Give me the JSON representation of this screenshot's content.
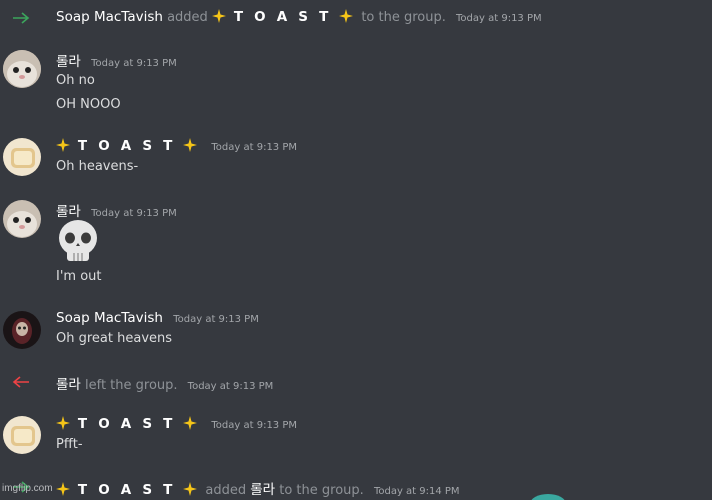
{
  "messages": {
    "join1": {
      "actor": "Soap MacTavish",
      "verb": "added",
      "target": "T O A S T",
      "suffix": "to the group.",
      "time": "Today at 9:13 PM"
    },
    "m1": {
      "author": "롤라",
      "time": "Today at 9:13 PM",
      "lines": [
        "Oh no",
        "OH NOOO"
      ]
    },
    "m2": {
      "author": "T O A S T",
      "time": "Today at 9:13 PM",
      "line": "Oh heavens-"
    },
    "m3": {
      "author": "롤라",
      "time": "Today at 9:13 PM",
      "emoji": "skull-emoji",
      "line": "I'm out"
    },
    "m4": {
      "author": "Soap MacTavish",
      "time": "Today at 9:13 PM",
      "line": "Oh great heavens"
    },
    "leave1": {
      "actor": "롤라",
      "suffix": "left the group.",
      "time": "Today at 9:13 PM"
    },
    "m5": {
      "author": "T O A S T",
      "time": "Today at 9:13 PM",
      "line": "Pfft-"
    },
    "join2": {
      "actor": "T O A S T",
      "verb": "added",
      "target": "롤라",
      "suffix": "to the group.",
      "time": "Today at 9:14 PM"
    }
  },
  "watermark": "imgflip.com",
  "colors": {
    "background": "#36393f",
    "join_arrow": "#3ba55c",
    "leave_arrow": "#ed4245",
    "sparkle": "#f5c518"
  }
}
